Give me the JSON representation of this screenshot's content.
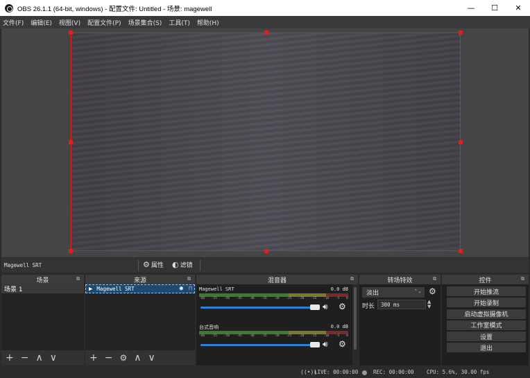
{
  "window": {
    "title": "OBS 26.1.1 (64-bit, windows) - 配置文件: Untitled - 场景: magewell",
    "minimize": "—",
    "maximize": "☐",
    "close": "✕"
  },
  "menu": [
    "文件(F)",
    "编辑(E)",
    "视图(V)",
    "配置文件(P)",
    "场景集合(S)",
    "工具(T)",
    "帮助(H)"
  ],
  "source_toolbar": {
    "source_name": "Magewell SRT",
    "properties_label": "属性",
    "filters_label": "滤镜"
  },
  "docks": {
    "scenes": {
      "title": "场景",
      "items": [
        "场景 1"
      ]
    },
    "sources": {
      "title": "来源",
      "items": [
        "Magewell SRT"
      ]
    },
    "mixer": {
      "title": "混音器",
      "channels": [
        {
          "name": "Magewell SRT",
          "db": "0.0 dB"
        },
        {
          "name": "台式音响",
          "db": "0.0 dB"
        }
      ],
      "ticks": [
        "-60",
        "-55",
        "-50",
        "-45",
        "-40",
        "-35",
        "-30",
        "-25",
        "-20",
        "-15",
        "-10",
        "-5",
        "0"
      ]
    },
    "transitions": {
      "title": "转场特效",
      "selected": "淡出",
      "duration_label": "时长",
      "duration_value": "300 ms"
    },
    "controls": {
      "title": "控件",
      "buttons": [
        "开始推流",
        "开始录制",
        "启动虚拟摄像机",
        "工作室模式",
        "设置",
        "退出"
      ]
    }
  },
  "status": {
    "live": "LIVE: 00:00:00",
    "rec": "REC: 00:00:00",
    "cpu": "CPU: 5.6%, 30.00 fps"
  },
  "colors": {
    "selection_border": "#e02020",
    "source_selected": "#1e4a72",
    "fader": "#2e82d6"
  }
}
